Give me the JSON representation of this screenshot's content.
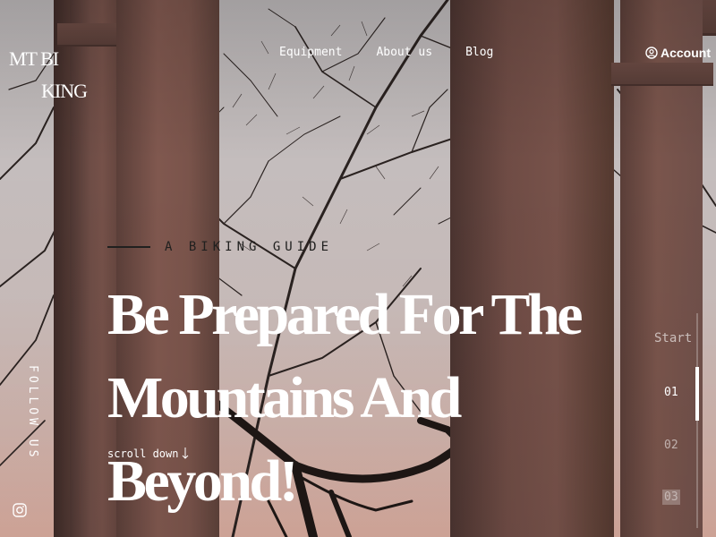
{
  "logo": {
    "line1": "MT BI",
    "line2": "KING"
  },
  "nav": {
    "items": [
      {
        "label": "Equipment"
      },
      {
        "label": "About us"
      },
      {
        "label": "Blog"
      }
    ],
    "account_label": "Account"
  },
  "hero": {
    "eyebrow": "A BIKING GUIDE",
    "headline_line1": "Be Prepared For The",
    "headline_line2": "Mountains And Beyond!",
    "scroll_label": "scroll down"
  },
  "social": {
    "follow_label": "FOLLOW US",
    "icon": "instagram-icon"
  },
  "slider": {
    "start_label": "Start",
    "slides": [
      "01",
      "02",
      "03"
    ],
    "active_index": 0
  },
  "colors": {
    "text": "#ffffff",
    "eyebrow": "#20201f",
    "column": "#6e4d46"
  }
}
